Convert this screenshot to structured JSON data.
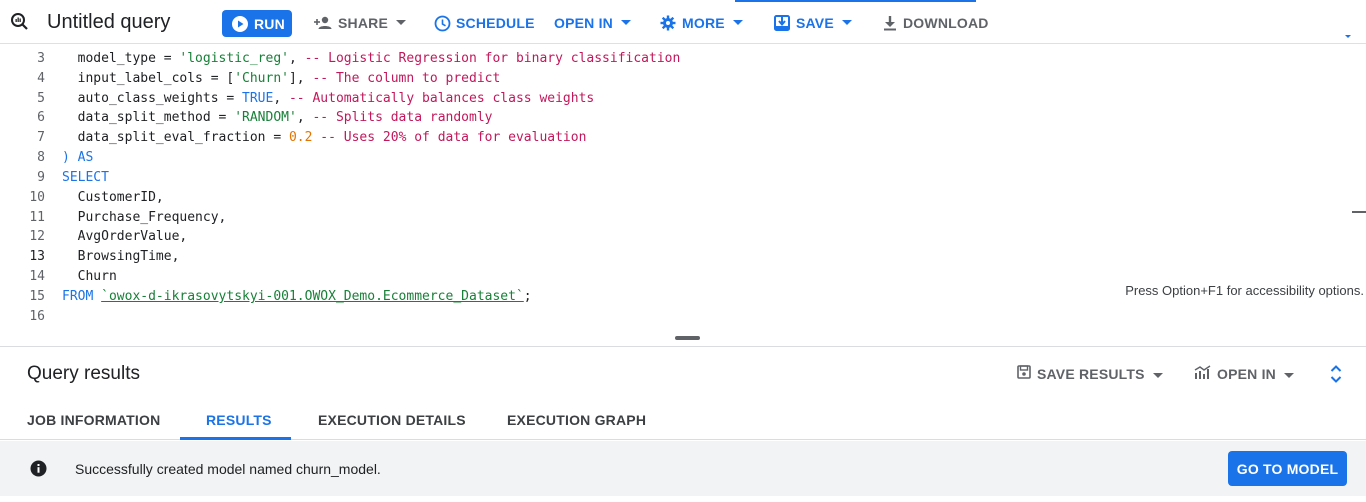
{
  "toolbar": {
    "title": "Untitled query",
    "run_label": "RUN",
    "share_label": "SHARE",
    "schedule_label": "SCHEDULE",
    "open_in_label": "OPEN IN",
    "more_label": "MORE",
    "save_label": "SAVE",
    "download_label": "DOWNLOAD"
  },
  "editor": {
    "line_numbers": [
      "3",
      "4",
      "5",
      "6",
      "7",
      "8",
      "9",
      "10",
      "11",
      "12",
      "13",
      "14",
      "15",
      "16"
    ],
    "active_line": "13",
    "lines": {
      "l3": {
        "a": "  model_type = ",
        "b": "'logistic_reg'",
        "c": ", ",
        "d": "-- Logistic Regression for binary classification"
      },
      "l4": {
        "a": "  input_label_cols = [",
        "b": "'Churn'",
        "c": "], ",
        "d": "-- The column to predict"
      },
      "l5": {
        "a": "  auto_class_weights = ",
        "b": "TRUE",
        "c": ", ",
        "d": "-- Automatically balances class weights"
      },
      "l6": {
        "a": "  data_split_method = ",
        "b": "'RANDOM'",
        "c": ", ",
        "d": "-- Splits data randomly"
      },
      "l7": {
        "a": "  data_split_eval_fraction = ",
        "b": "0.2",
        "c": " ",
        "d": "-- Uses 20% of data for evaluation"
      },
      "l8": {
        "a": ") AS"
      },
      "l9": {
        "a": "SELECT"
      },
      "l10": {
        "a": "  CustomerID,"
      },
      "l11": {
        "a": "  Purchase_Frequency,"
      },
      "l12": {
        "a": "  AvgOrderValue,"
      },
      "l13": {
        "a": "  BrowsingTime,"
      },
      "l14": {
        "a": "  Churn"
      },
      "l15": {
        "a": "FROM",
        "b": " ",
        "c": "`owox-d-ikrasovytskyi-001.OWOX_Demo.Ecommerce_Dataset`",
        "d": ";"
      },
      "l16": {
        "a": ""
      }
    },
    "accessibility_hint": "Press Option+F1 for accessibility options."
  },
  "results": {
    "title": "Query results",
    "save_results_label": "SAVE RESULTS",
    "open_in_label": "OPEN IN",
    "tabs": [
      "JOB INFORMATION",
      "RESULTS",
      "EXECUTION DETAILS",
      "EXECUTION GRAPH"
    ],
    "active_tab": "RESULTS",
    "message": "Successfully created model named churn_model.",
    "goto_model_label": "GO TO MODEL"
  },
  "colors": {
    "accent": "#1a73e8",
    "string": "#188038",
    "comment": "#c2185b",
    "number": "#e37400"
  },
  "icons": [
    "query-icon",
    "play-icon",
    "person-add-icon",
    "clock-icon",
    "gear-icon",
    "save-icon",
    "download-icon",
    "chevron-down-icon",
    "info-icon",
    "chart-icon",
    "expand-icon"
  ]
}
